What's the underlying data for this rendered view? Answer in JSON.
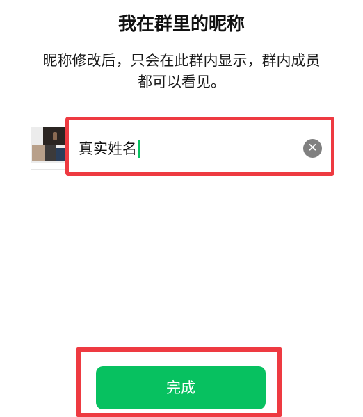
{
  "page": {
    "title": "我在群里的昵称",
    "description_line1": "昵称修改后，只会在此群内显示，群内成员",
    "description_line2": "都可以看见。"
  },
  "nickname": {
    "value": "真实姓名",
    "clear_icon": "clear-icon",
    "clear_glyph": "✕"
  },
  "done_button": {
    "label": "完成"
  },
  "colors": {
    "accent_green": "#07c160",
    "highlight_red": "#ee3a41",
    "clear_gray": "#808080"
  }
}
